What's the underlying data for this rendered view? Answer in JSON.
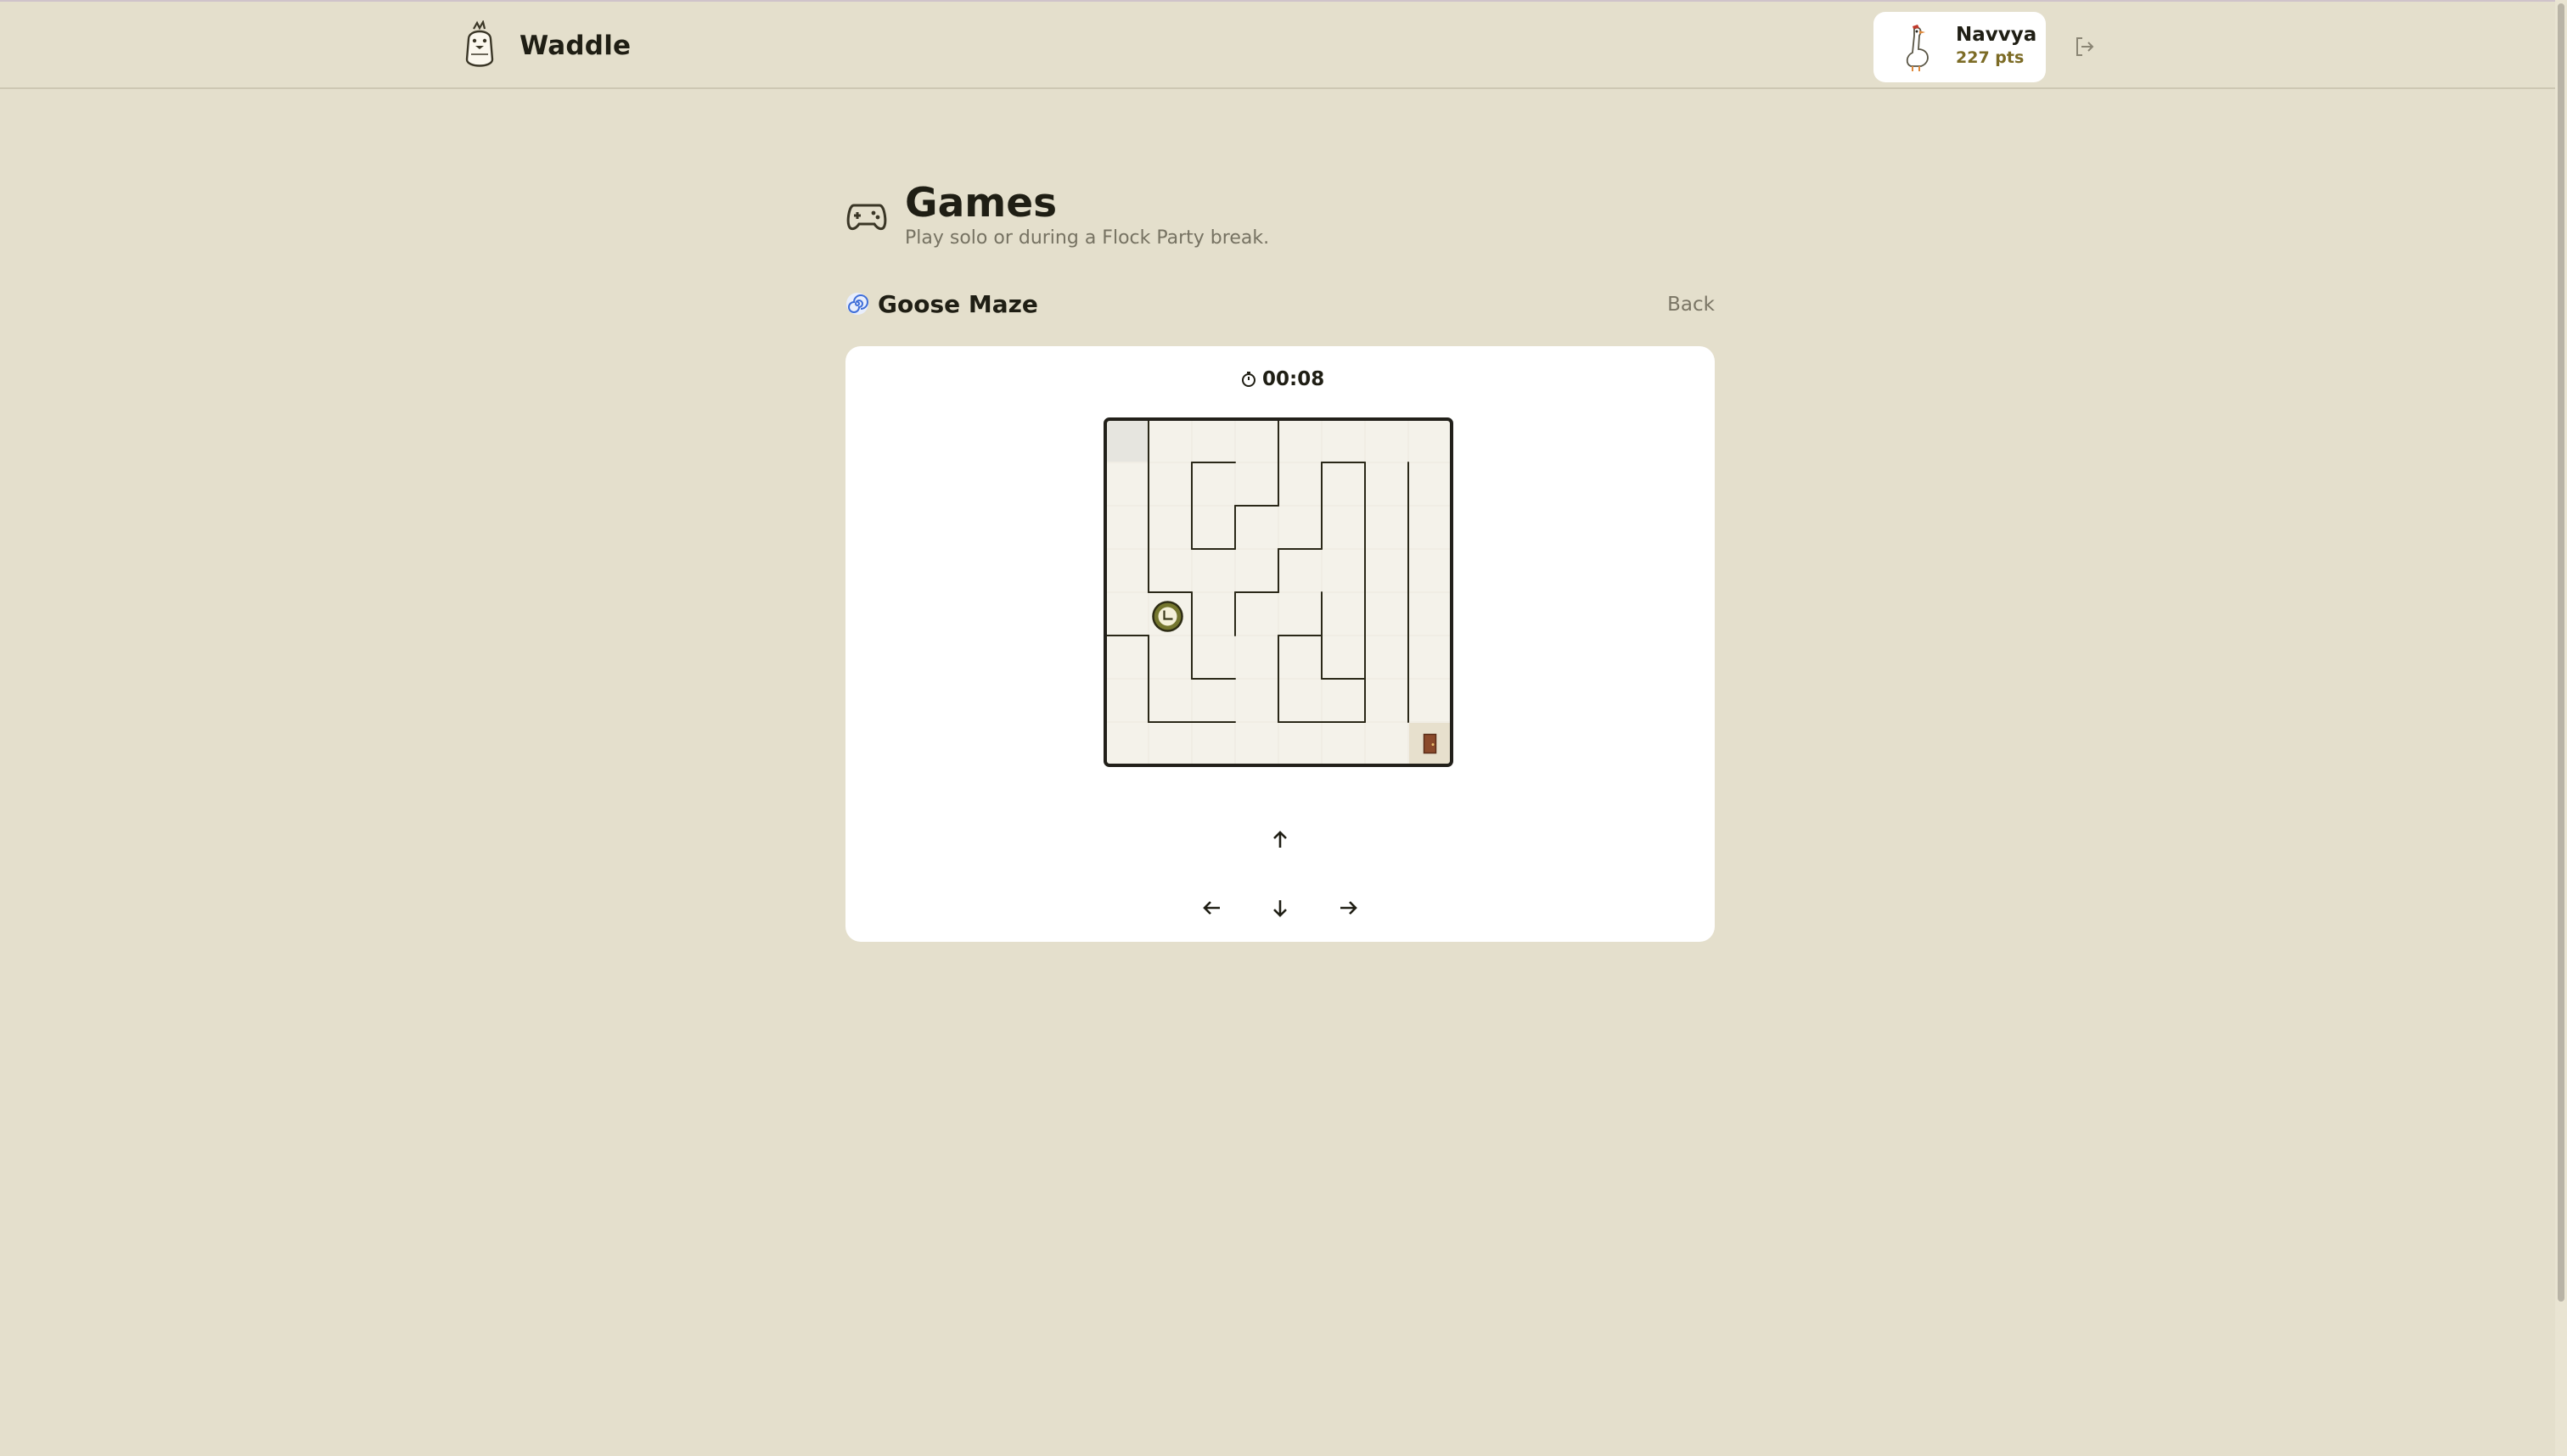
{
  "app": {
    "name": "Waddle"
  },
  "user": {
    "name": "Navvya",
    "points": "227 pts"
  },
  "page": {
    "title": "Games",
    "subtitle": "Play solo or during a Flock Party break."
  },
  "game": {
    "title": "Goose Maze",
    "back_label": "Back",
    "timer": "00:08"
  },
  "maze": {
    "cols": 8,
    "rows": 8,
    "player": {
      "col": 1,
      "row": 4
    },
    "start": {
      "col": 0,
      "row": 0
    },
    "exit": {
      "col": 7,
      "row": 7
    },
    "walls": [
      [
        1,
        0,
        1,
        4
      ],
      [
        4,
        0,
        4,
        2
      ],
      [
        2,
        1,
        3,
        1
      ],
      [
        2,
        1,
        2,
        3
      ],
      [
        3,
        2,
        4,
        2
      ],
      [
        3,
        2,
        3,
        3
      ],
      [
        2,
        3,
        3,
        3
      ],
      [
        5,
        1,
        6,
        1
      ],
      [
        5,
        1,
        5,
        3
      ],
      [
        6,
        1,
        6,
        7
      ],
      [
        4,
        3,
        5,
        3
      ],
      [
        4,
        3,
        4,
        4
      ],
      [
        3,
        4,
        4,
        4
      ],
      [
        3,
        4,
        3,
        5
      ],
      [
        1,
        4,
        2,
        4
      ],
      [
        2,
        4,
        2,
        6
      ],
      [
        2,
        6,
        3,
        6
      ],
      [
        4,
        5,
        5,
        5
      ],
      [
        5,
        4,
        5,
        6
      ],
      [
        4,
        5,
        4,
        7
      ],
      [
        4,
        7,
        6,
        7
      ],
      [
        6,
        6,
        5,
        6
      ],
      [
        0,
        5,
        1,
        5
      ],
      [
        1,
        5,
        1,
        7
      ],
      [
        1,
        7,
        3,
        7
      ],
      [
        7,
        1,
        7,
        7
      ]
    ],
    "icons": {
      "player": "goose-token-icon",
      "exit": "door-icon"
    }
  },
  "controls": {
    "up": "arrow-up-icon",
    "down": "arrow-down-icon",
    "left": "arrow-left-icon",
    "right": "arrow-right-icon"
  }
}
